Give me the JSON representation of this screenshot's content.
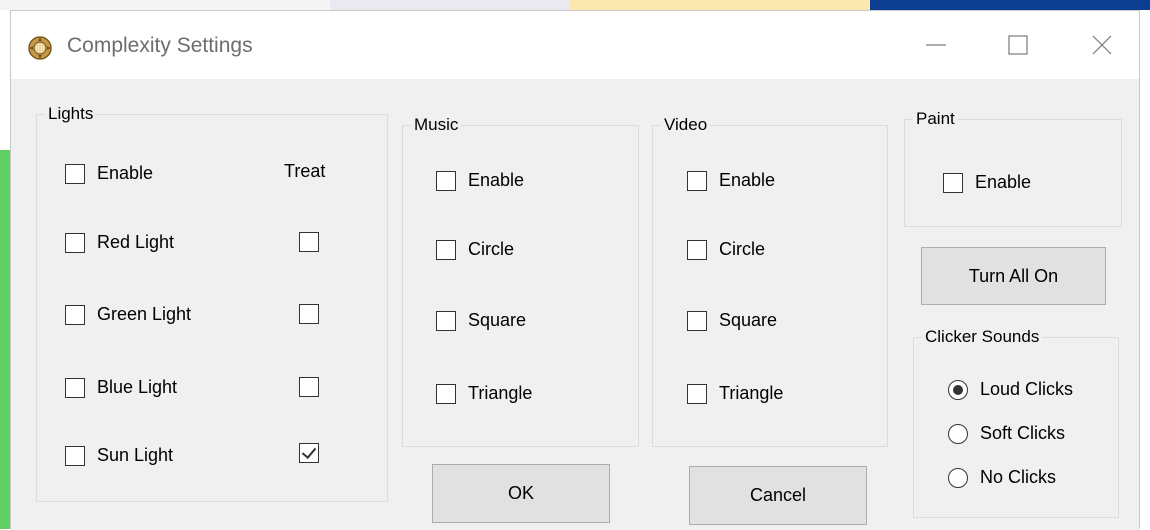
{
  "window": {
    "title": "Complexity Settings",
    "icon": "gear-icon",
    "controls": {
      "minimize": "minimize-icon",
      "maximize": "maximize-icon",
      "close": "close-icon"
    }
  },
  "lights": {
    "title": "Lights",
    "treat_header": "Treat",
    "items": [
      {
        "label": "Enable",
        "checked": false
      },
      {
        "label": "Red Light",
        "checked": false,
        "treat": false
      },
      {
        "label": "Green Light",
        "checked": false,
        "treat": false
      },
      {
        "label": "Blue Light",
        "checked": false,
        "treat": false
      },
      {
        "label": "Sun Light",
        "checked": false,
        "treat": true
      }
    ]
  },
  "music": {
    "title": "Music",
    "items": [
      {
        "label": "Enable",
        "checked": false
      },
      {
        "label": "Circle",
        "checked": false
      },
      {
        "label": "Square",
        "checked": false
      },
      {
        "label": "Triangle",
        "checked": false
      }
    ]
  },
  "video": {
    "title": "Video",
    "items": [
      {
        "label": "Enable",
        "checked": false
      },
      {
        "label": "Circle",
        "checked": false
      },
      {
        "label": "Square",
        "checked": false
      },
      {
        "label": "Triangle",
        "checked": false
      }
    ]
  },
  "paint": {
    "title": "Paint",
    "items": [
      {
        "label": "Enable",
        "checked": false
      }
    ]
  },
  "turn_all_on_label": "Turn All On",
  "clicker_sounds": {
    "title": "Clicker Sounds",
    "selected": "Loud Clicks",
    "options": [
      "Loud Clicks",
      "Soft Clicks",
      "No Clicks"
    ]
  },
  "buttons": {
    "ok": "OK",
    "cancel": "Cancel"
  },
  "colors": {
    "dialog_bg": "#f0f0f0",
    "title_text": "#6d6d6d",
    "button_bg": "#e1e1e1",
    "group_border": "#dcdcdc",
    "background_edge": "#5fcf63"
  }
}
